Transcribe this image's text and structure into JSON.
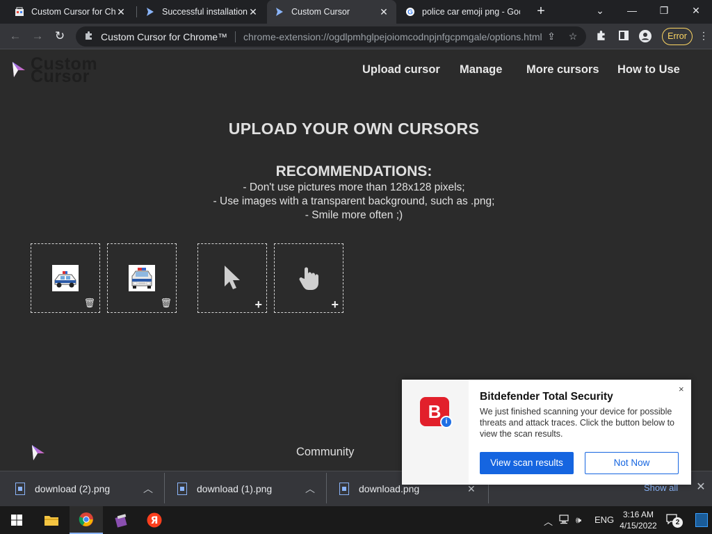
{
  "browser": {
    "tabs": [
      {
        "title": "Custom Cursor for Chrome™ - Chrome Web Store",
        "icon": "chrome-web-store-icon"
      },
      {
        "title": "Successful installation - Custom Cursor",
        "icon": "custom-cursor-icon"
      },
      {
        "title": "Custom Cursor",
        "icon": "custom-cursor-icon",
        "active": true
      },
      {
        "title": "police car emoji png - Google Search",
        "icon": "google-icon"
      }
    ],
    "new_tab_label": "+",
    "window_controls": {
      "minimize": "—",
      "restore": "❐",
      "close": "✕",
      "tab_search": "⌄"
    },
    "omnibox": {
      "site_name": "Custom Cursor for Chrome™",
      "url": "chrome-extension://ogdlpmhglpejoiomcodnpjnfgcpmgale/options.html"
    },
    "profile_error_label": "Error"
  },
  "page": {
    "logo_text": "Custom Cursor",
    "nav": [
      "Upload cursor",
      "Manage",
      "More cursors",
      "How to Use"
    ],
    "heading": "UPLOAD YOUR OWN CURSORS",
    "recommendations_title": "RECOMMENDATIONS:",
    "recommendations": [
      "- Don't use pictures more than 128x128 pixels;",
      "- Use images with a transparent background, such as .png;",
      "- Smile more often ;)"
    ],
    "slots": [
      {
        "content": "police-car-side-image",
        "action": "delete"
      },
      {
        "content": "police-car-front-image",
        "action": "delete"
      },
      {
        "content": "arrow-cursor-placeholder",
        "action": "add"
      },
      {
        "content": "hand-pointer-placeholder",
        "action": "add"
      }
    ],
    "footer_community": "Community"
  },
  "downloads": {
    "items": [
      {
        "name": "download (2).png"
      },
      {
        "name": "download (1).png"
      },
      {
        "name": "download.png"
      }
    ],
    "show_all": "Show all"
  },
  "toast": {
    "title": "Bitdefender Total Security",
    "body": "We just finished scanning your device for possible threats and attack traces. Click the button below to view the scan results.",
    "primary_button": "View scan results",
    "secondary_button": "Not Now",
    "close": "×",
    "logo_letter": "B",
    "brand_color": "#e2202b",
    "accent_color": "#1565e0"
  },
  "taskbar": {
    "language": "ENG",
    "time": "3:16 AM",
    "date": "4/15/2022",
    "notification_count": "2",
    "yandex_letter": "Я"
  }
}
